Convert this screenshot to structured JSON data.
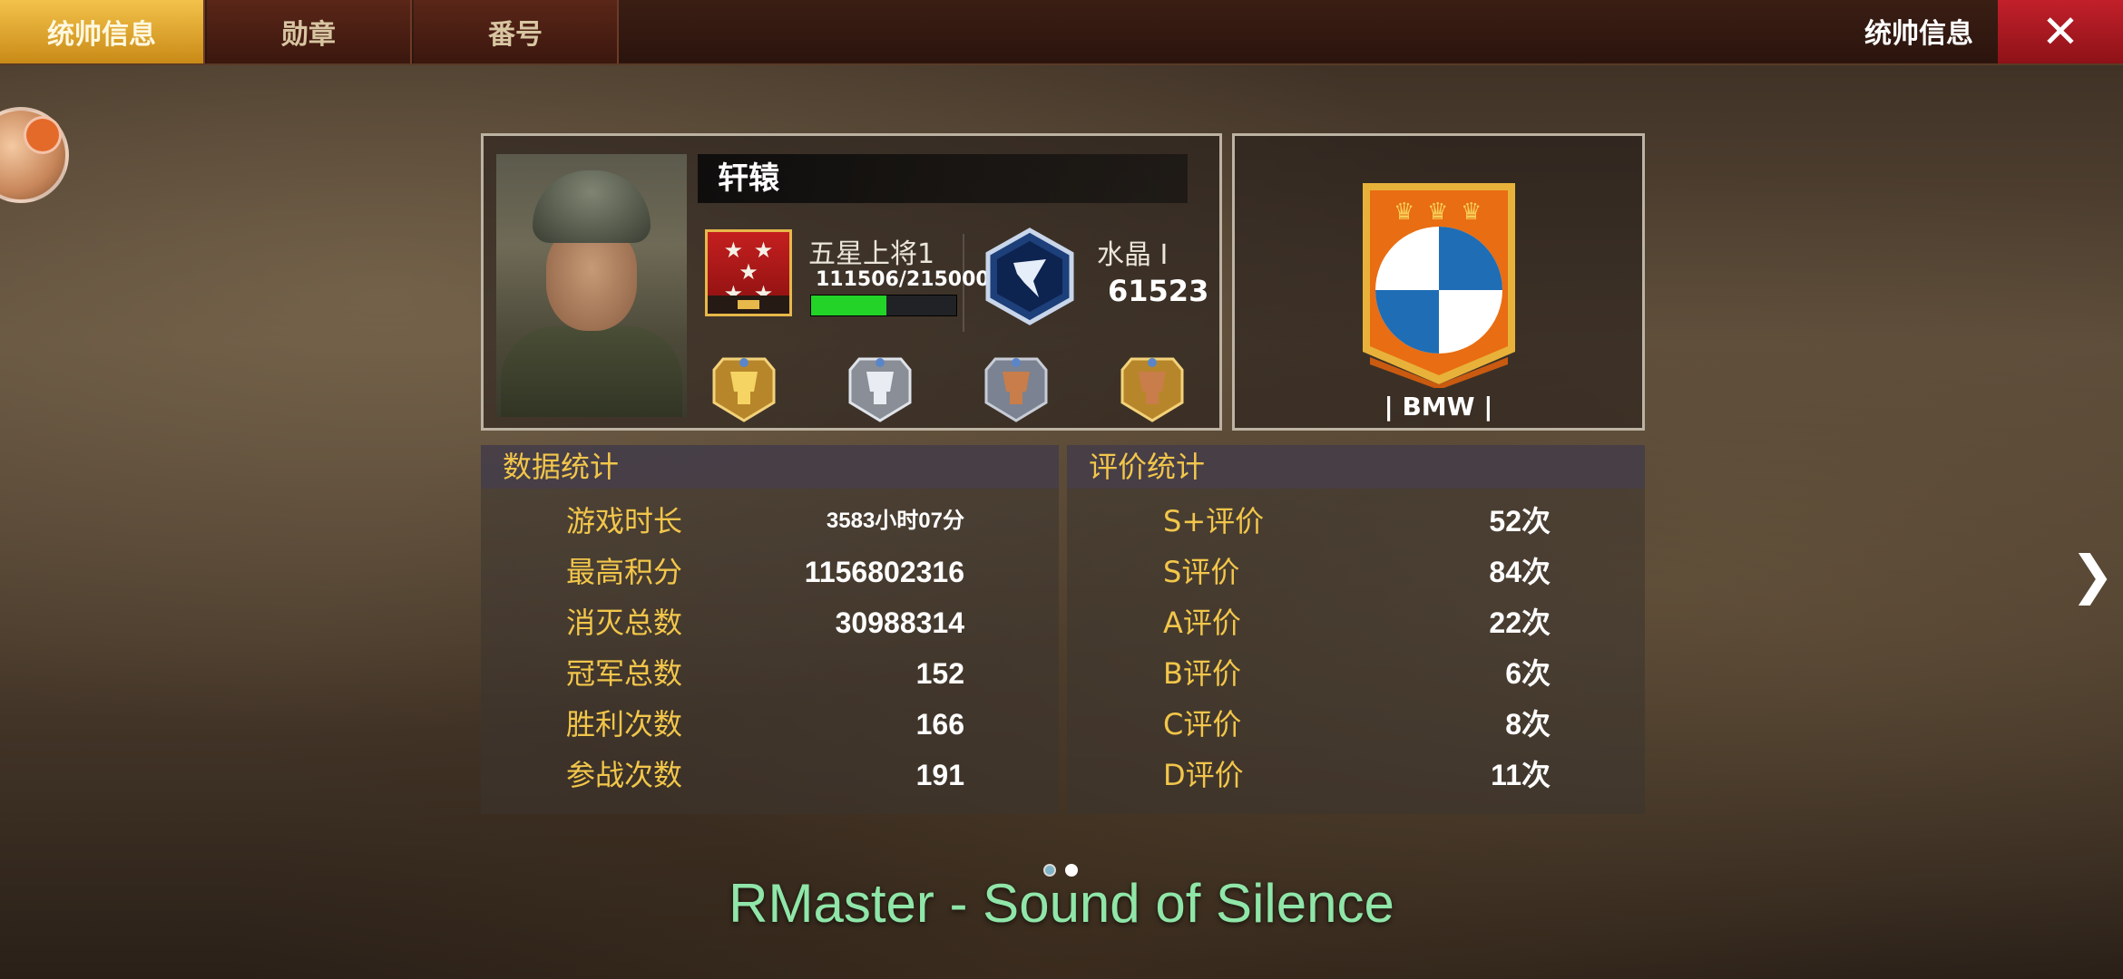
{
  "tabs": [
    {
      "label": "统帅信息",
      "active": true
    },
    {
      "label": "勋章",
      "active": false
    },
    {
      "label": "番号",
      "active": false
    }
  ],
  "header": {
    "title": "统帅信息",
    "close_icon": "close-icon"
  },
  "profile": {
    "name": "轩辕",
    "rank": {
      "name": "五星上将1",
      "exp_text": "111506/215000",
      "progress": 0.52
    },
    "tier": {
      "label": "水晶 Ⅰ",
      "score": "61523"
    }
  },
  "clan": {
    "name": "| BMW |"
  },
  "data_stats": {
    "title": "数据统计",
    "rows": [
      {
        "label": "游戏时长",
        "value": "3583小时07分"
      },
      {
        "label": "最高积分",
        "value": "1156802316"
      },
      {
        "label": "消灭总数",
        "value": "30988314"
      },
      {
        "label": "冠军总数",
        "value": "152"
      },
      {
        "label": "胜利次数",
        "value": "166"
      },
      {
        "label": "参战次数",
        "value": "191"
      }
    ]
  },
  "rating_stats": {
    "title": "评价统计",
    "rows": [
      {
        "label": "S+评价",
        "value": "52次"
      },
      {
        "label": "S评价",
        "value": "84次"
      },
      {
        "label": "A评价",
        "value": "22次"
      },
      {
        "label": "B评价",
        "value": "6次"
      },
      {
        "label": "C评价",
        "value": "8次"
      },
      {
        "label": "D评价",
        "value": "11次"
      }
    ]
  },
  "nav": {
    "next_symbol": "❯"
  },
  "overlay_caption": "RMaster - Sound of Silence",
  "colors": {
    "accent_gold": "#f2c64a",
    "close_red": "#c2202a",
    "exp_green": "#23d327",
    "caption_green": "#8fe6a8"
  }
}
